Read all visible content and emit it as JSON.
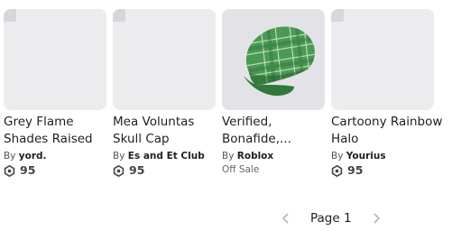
{
  "items": [
    {
      "title": "Grey Flame Shades Raised",
      "by_label": "By",
      "creator": "yord.",
      "price": "95",
      "has_image": false
    },
    {
      "title": "Mea Voluntas Skull Cap",
      "by_label": "By",
      "creator": "Es and Et Club",
      "price": "95",
      "has_image": false
    },
    {
      "title": "Verified, Bonafide,...",
      "by_label": "By",
      "creator": "Roblox",
      "status": "Off Sale",
      "has_image": true,
      "image_icon": "green-plaid-cap"
    },
    {
      "title": "Cartoony Rainbow Halo",
      "by_label": "By",
      "creator": "Yourius",
      "price": "95",
      "has_image": false
    }
  ],
  "pagination": {
    "label": "Page 1",
    "prev_icon": "chevron-left-icon",
    "next_icon": "chevron-right-icon"
  },
  "colors": {
    "thumb_bg": "#ececef",
    "cap_green": "#3f8f4a",
    "text": "#1f1f1f",
    "muted": "#555555"
  }
}
